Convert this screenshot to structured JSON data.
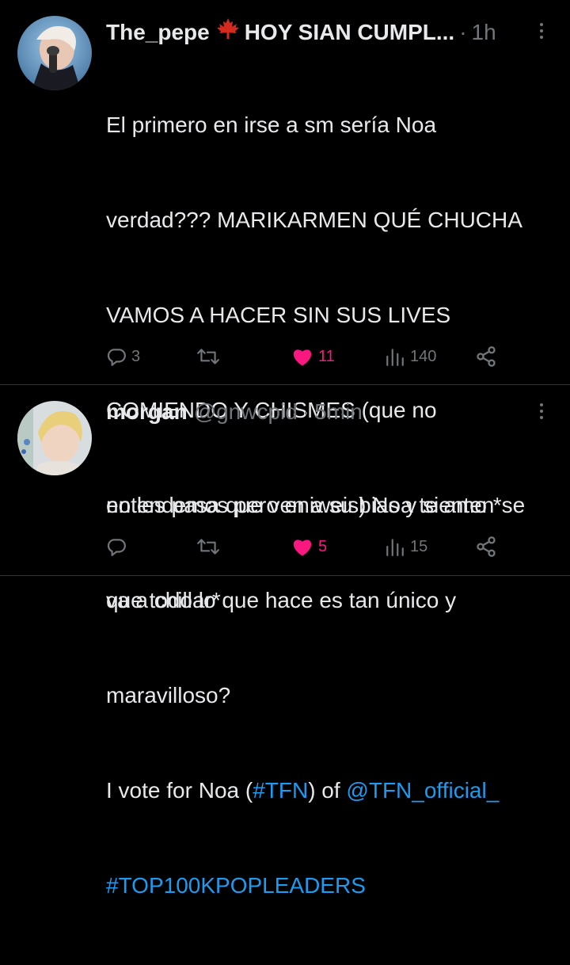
{
  "tweets": [
    {
      "name": "The_pepe",
      "name_suffix": "HOY SIAN CUMPL...",
      "dot": "·",
      "time": "1h",
      "body_lines": [
        "El primero en irse a sm sería Noa",
        "verdad??? MARIKARMEN QUÉ CHUCHA",
        "VAMOS A HACER SIN SUS LIVES",
        "COMIENDO Y CHISMES (que no",
        "entendemos pero eniweis) Noa te amo *se",
        "va a chillar*"
      ],
      "vote_prefix": "I vote for Noa (",
      "vote_tag": "#TFN",
      "vote_mid": ") of ",
      "vote_mention": "@TFN_official_",
      "vote_tag2": "#TOP100KPOPLEADERS",
      "replies": "3",
      "retweets": "",
      "likes": "11",
      "views": "140"
    },
    {
      "name": "morgan",
      "handle": "@gnwcpid",
      "dot": "·",
      "time": "5min",
      "body_lines": [
        "no les pasa que ven a su bias y sienten",
        "que todo lo que hace es tan único y",
        "maravilloso?"
      ],
      "replies": "",
      "retweets": "",
      "likes": "5",
      "views": "15"
    }
  ],
  "colors": {
    "background": "#000000",
    "text": "#e7e9ea",
    "muted": "#71767b",
    "link": "#1d9bf0",
    "like": "#f91880",
    "maple_leaf": "#d52b1e",
    "divider": "#2f3336"
  },
  "icons": {
    "reply": "reply-icon",
    "retweet": "retweet-icon",
    "like": "heart-icon",
    "views": "views-icon",
    "share": "share-icon",
    "more": "more-icon",
    "emoji": "maple-leaf-icon"
  }
}
